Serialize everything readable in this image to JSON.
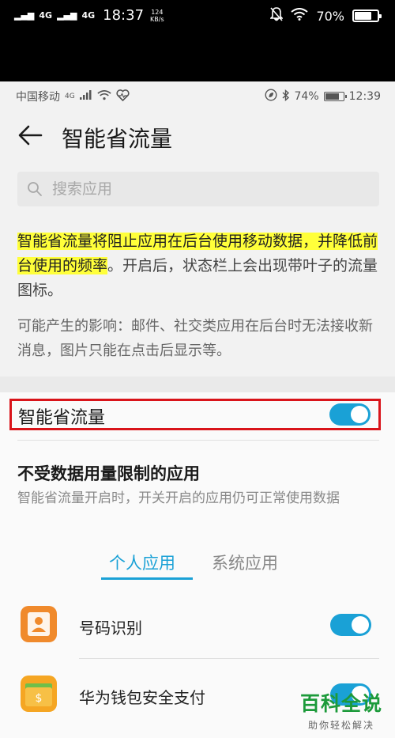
{
  "outer_status": {
    "signal1": "4G",
    "signal2": "4G",
    "time": "18:37",
    "speed_value": "124",
    "speed_unit": "KB/s",
    "battery": "70%",
    "battery_level": 0.7
  },
  "inner_status": {
    "carrier": "中国移动",
    "network": "4G",
    "battery": "74%",
    "battery_level": 0.74,
    "time": "12:39"
  },
  "header": {
    "title": "智能省流量"
  },
  "search": {
    "placeholder": "搜索应用"
  },
  "description": {
    "highlighted": "智能省流量将阻止应用在后台使用移动数据，并降低前台使用的频率",
    "rest": "。开启后，状态栏上会出现带叶子的流量图标。",
    "impact": "可能产生的影响：邮件、社交类应用在后台时无法接收新消息，图片只能在点击后显示等。"
  },
  "main_toggle": {
    "label": "智能省流量",
    "on": true
  },
  "unrestricted": {
    "title": "不受数据用量限制的应用",
    "subtitle": "智能省流量开启时，开关开启的应用仍可正常使用数据"
  },
  "tabs": [
    {
      "label": "个人应用",
      "active": true
    },
    {
      "label": "系统应用",
      "active": false
    }
  ],
  "apps": [
    {
      "name": "号码识别",
      "icon": "contact-card-icon",
      "color": "#f08a2c",
      "on": true
    },
    {
      "name": "华为钱包安全支付",
      "icon": "wallet-icon",
      "color": "#f5a623",
      "on": true
    }
  ],
  "colors": {
    "accent": "#1aa1d6",
    "highlight": "#ffff3a",
    "outline": "#d9141a"
  },
  "watermark": {
    "main": "百科全说",
    "sub": "助你轻松解决"
  }
}
